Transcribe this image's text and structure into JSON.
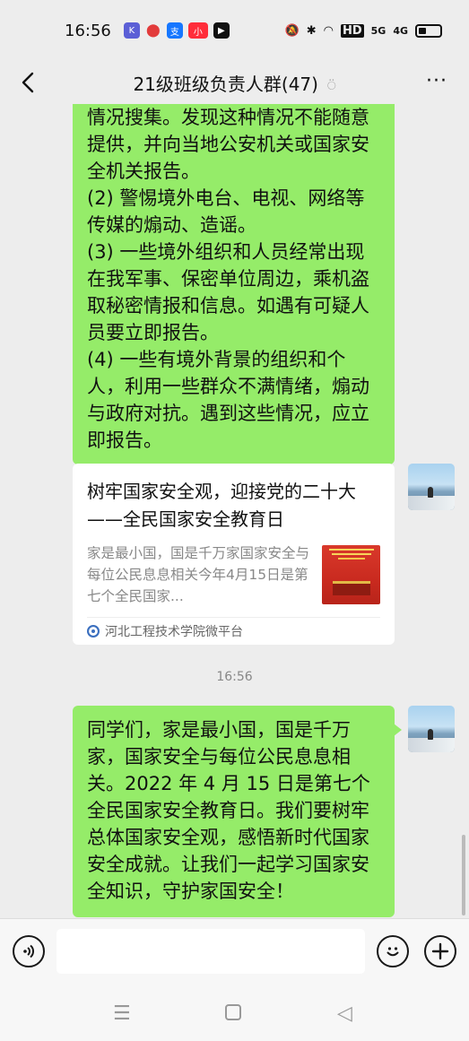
{
  "status_bar": {
    "time": "16:56",
    "apps": [
      {
        "icon": "k-app-icon",
        "color": "#5b5fd6",
        "glyph": "K"
      },
      {
        "icon": "map-pin-icon",
        "color": "#e8e8e8",
        "glyph": "📍"
      },
      {
        "icon": "alipay-icon",
        "color": "#1677ff",
        "glyph": "支"
      },
      {
        "icon": "red-app-icon",
        "color": "#ff2d3a",
        "glyph": "小"
      },
      {
        "icon": "video-app-icon",
        "color": "#111111",
        "glyph": "▶"
      }
    ],
    "signal_labels": [
      "HD",
      "5G",
      "4G"
    ]
  },
  "nav": {
    "title": "21级班级负责人群(47)"
  },
  "messages": {
    "bubble1_lines": [
      "情况搜集。发现这种情况不能随意提供，并向当地公安机关或国家安全机关报告。",
      "(2) 警惕境外电台、电视、网络等传媒的煽动、造谣。",
      "(3) 一些境外组织和人员经常出现在我军事、保密单位周边，乘机盗取秘密情报和信息。如遇有可疑人员要立即报告。",
      "(4) 一些有境外背景的组织和个人，利用一些群众不满情绪，煽动与政府对抗。遇到这些情况，应立即报告。"
    ],
    "card": {
      "title": "树牢国家安全观，迎接党的二十大——全民国家安全教育日",
      "description": "家是最小国，国是千万家国家安全与每位公民息息相关今年4月15日是第七个全民国家...",
      "source": "河北工程技术学院微平台"
    },
    "timestamp": "16:56",
    "bubble2_text": "同学们，家是最小国，国是千万家，国家安全与每位公民息息相关。2022 年 4 月 15 日是第七个全民国家安全教育日。我们要树牢总体国家安全观，感悟新时代国家安全成就。让我们一起学习国家安全知识，守护家国安全！"
  },
  "input_bar": {
    "voice_icon": "voice-icon",
    "emoji_icon": "emoji-icon",
    "plus_icon": "plus-icon"
  },
  "colors": {
    "bubble": "#95ec69",
    "background": "#ededed"
  }
}
